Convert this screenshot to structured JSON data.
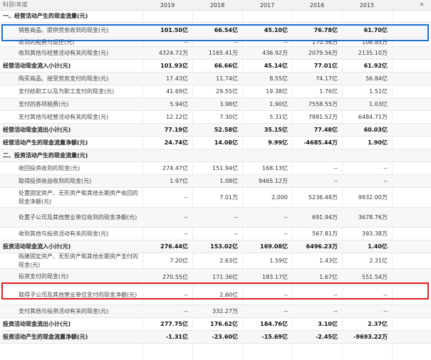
{
  "header": {
    "label": "科目\\年度",
    "years": [
      "2019",
      "2018",
      "2017",
      "2016",
      "2015"
    ],
    "next_icon": "double-chevron-right-icon"
  },
  "rows": [
    {
      "label": "一、经营活动产生的现金流量(元)",
      "type": "section",
      "values": [
        "",
        "",
        "",
        "",
        ""
      ]
    },
    {
      "label": "销售商品、提供劳务收到的现金(元)",
      "type": "sub-bold",
      "values": [
        "101.50亿",
        "66.54亿",
        "45.10亿",
        "76.78亿",
        "61.70亿"
      ]
    },
    {
      "label": "收到的税费与返还(元)",
      "type": "sub",
      "values": [
        "--",
        "--",
        "--",
        "170.56万",
        "106.85万"
      ]
    },
    {
      "label": "收到其他与经营活动有关的现金(元)",
      "type": "sub",
      "values": [
        "4324.72万",
        "1165.41万",
        "436.92万",
        "2079.56万",
        "2135.10万"
      ]
    },
    {
      "label": "经营活动现金流入小计(元)",
      "type": "bold",
      "values": [
        "101.93亿",
        "66.66亿",
        "45.14亿",
        "77.01亿",
        "61.92亿"
      ]
    },
    {
      "label": "购买商品、接受劳务支付的现金(元)",
      "type": "sub",
      "values": [
        "17.43亿",
        "11.74亿",
        "8.55亿",
        "74.17亿",
        "56.84亿"
      ]
    },
    {
      "label": "支付给职工以及为职工支付的现金(元)",
      "type": "sub",
      "values": [
        "41.69亿",
        "29.55亿",
        "19.38亿",
        "1.76亿",
        "1.51亿"
      ]
    },
    {
      "label": "支付的各项税费(元)",
      "type": "sub",
      "values": [
        "5.94亿",
        "3.98亿",
        "1.90亿",
        "7558.55万",
        "1.03亿"
      ]
    },
    {
      "label": "支付其他与经营活动有关的现金(元)",
      "type": "sub",
      "values": [
        "12.12亿",
        "7.30亿",
        "5.31亿",
        "7881.52万",
        "6484.71万"
      ]
    },
    {
      "label": "经营活动现金流出小计(元)",
      "type": "bold",
      "values": [
        "77.19亿",
        "52.58亿",
        "35.15亿",
        "77.48亿",
        "60.03亿"
      ]
    },
    {
      "label": "经营活动产生的现金流量净额(元)",
      "type": "bold",
      "values": [
        "24.74亿",
        "14.08亿",
        "9.99亿",
        "-4685.44万",
        "1.90亿"
      ]
    },
    {
      "label": "二、投资活动产生的现金流量(元)",
      "type": "section",
      "values": [
        "",
        "",
        "",
        "",
        ""
      ]
    },
    {
      "label": "收回投资收到的现金(元)",
      "type": "sub",
      "values": [
        "274.47亿",
        "151.94亿",
        "168.13亿",
        "--",
        "--"
      ]
    },
    {
      "label": "取得投资收益收到的现金(元)",
      "type": "sub",
      "values": [
        "1.97亿",
        "1.08亿",
        "9465.12万",
        "--",
        "--"
      ]
    },
    {
      "label": "处置固定资产、无形资产和其他长期资产收回的现金净额(元)",
      "type": "sub-tall",
      "values": [
        "--",
        "7.01万",
        "2,000",
        "5236.48万",
        "9932.00万"
      ]
    },
    {
      "label": "处置子公司及其他营业单位收到的现金净额(元)",
      "type": "sub-tall",
      "values": [
        "--",
        "--",
        "--",
        "691.94万",
        "3678.76万"
      ]
    },
    {
      "label": "收到其他与投资活动有关的现金(元)",
      "type": "sub",
      "values": [
        "--",
        "--",
        "--",
        "567.81万",
        "393.38万"
      ]
    },
    {
      "label": "投资活动现金流入小计(元)",
      "type": "bold",
      "values": [
        "276.44亿",
        "153.02亿",
        "169.08亿",
        "6496.23万",
        "1.40亿"
      ]
    },
    {
      "label": "购建固定资产、无形资产和其他长期资产支付的现金(元)",
      "type": "sub-tall",
      "values": [
        "7.20亿",
        "2.63亿",
        "1.59亿",
        "1.43亿",
        "2.31亿"
      ]
    },
    {
      "label": "投资支付的现金(元)",
      "type": "sub",
      "values": [
        "270.55亿",
        "171.36亿",
        "183.17亿",
        "1.67亿",
        "551.54万"
      ]
    },
    {
      "label": "取得子公司及其他营业单位支付的现金净额(元)",
      "type": "sub-tall",
      "values": [
        "--",
        "2.60亿",
        "--",
        "--",
        "--"
      ]
    },
    {
      "label": "支付其他与投资活动有关的现金(元)",
      "type": "sub",
      "values": [
        "--",
        "332.27万",
        "--",
        "--",
        "--"
      ]
    },
    {
      "label": "投资活动现金流出小计(元)",
      "type": "bold",
      "values": [
        "277.75亿",
        "176.62亿",
        "184.76亿",
        "3.10亿",
        "2.37亿"
      ]
    },
    {
      "label": "投资活动产生的现金流量净额(元)",
      "type": "bold",
      "values": [
        "-1.31亿",
        "-23.60亿",
        "-15.69亿",
        "-2.45亿",
        "-9693.22万"
      ]
    }
  ],
  "highlights": {
    "blue_color": "#1f6fd1",
    "red_color": "#e02020"
  }
}
